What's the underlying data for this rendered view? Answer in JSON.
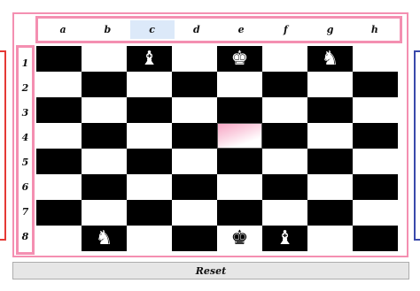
{
  "files": [
    {
      "label": "a",
      "selected": false
    },
    {
      "label": "b",
      "selected": false
    },
    {
      "label": "c",
      "selected": true
    },
    {
      "label": "d",
      "selected": false
    },
    {
      "label": "e",
      "selected": false
    },
    {
      "label": "f",
      "selected": false
    },
    {
      "label": "g",
      "selected": false
    },
    {
      "label": "h",
      "selected": false
    }
  ],
  "ranks": [
    "1",
    "2",
    "3",
    "4",
    "5",
    "6",
    "7",
    "8"
  ],
  "highlight_square": "e4",
  "pieces": [
    {
      "square": "c1",
      "glyph": "♝",
      "name": "bishop-icon",
      "side": "black"
    },
    {
      "square": "e1",
      "glyph": "♚",
      "name": "king-icon",
      "side": "black"
    },
    {
      "square": "g1",
      "glyph": "♞",
      "name": "knight-icon",
      "side": "black"
    },
    {
      "square": "b8",
      "glyph": "♞",
      "name": "knight-icon",
      "side": "white"
    },
    {
      "square": "e8",
      "glyph": "♚",
      "name": "king-icon",
      "side": "white"
    },
    {
      "square": "f8",
      "glyph": "♝",
      "name": "bishop-icon",
      "side": "white"
    }
  ],
  "reset_label": "Reset",
  "colors": {
    "frame": "#f48fb1",
    "left_panel": "#e53935",
    "right_panel": "#3949ab",
    "selected_file": "#dce9f9"
  }
}
